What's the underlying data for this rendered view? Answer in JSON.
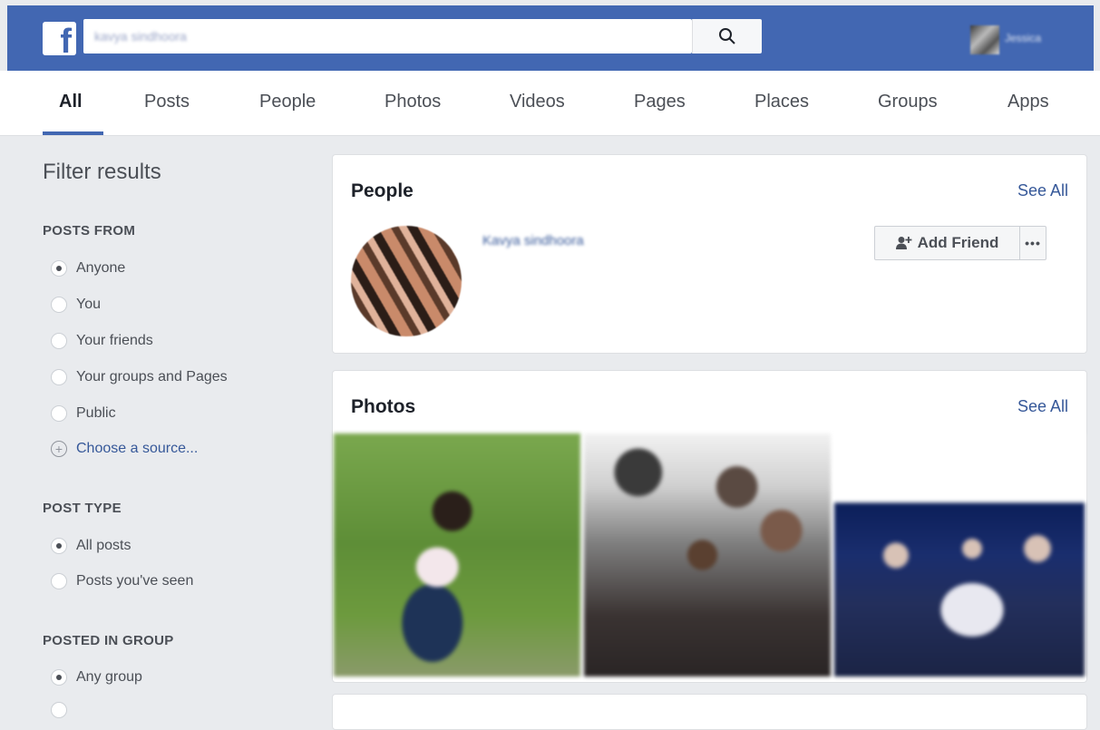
{
  "header": {
    "logo": "f",
    "search_value": "kavya sindhoora",
    "user_name": "Jessica"
  },
  "tabs": [
    "All",
    "Posts",
    "People",
    "Photos",
    "Videos",
    "Pages",
    "Places",
    "Groups",
    "Apps"
  ],
  "sidebar": {
    "title": "Filter results",
    "posts_from": {
      "heading": "POSTS FROM",
      "options": [
        "Anyone",
        "You",
        "Your friends",
        "Your groups and Pages",
        "Public"
      ],
      "selected": "Anyone",
      "choose_source": "Choose a source..."
    },
    "post_type": {
      "heading": "POST TYPE",
      "options": [
        "All posts",
        "Posts you've seen"
      ],
      "selected": "All posts"
    },
    "posted_in_group": {
      "heading": "POSTED IN GROUP",
      "options": [
        "Any group"
      ],
      "selected": "Any group"
    }
  },
  "people_card": {
    "title": "People",
    "see_all": "See All",
    "person_name": "Kavya sindhoora",
    "add_friend": "Add Friend",
    "more": "•••"
  },
  "photos_card": {
    "title": "Photos",
    "see_all": "See All"
  },
  "colors": {
    "brand_blue": "#4267b2",
    "link": "#365899",
    "background": "#e9ebee"
  }
}
